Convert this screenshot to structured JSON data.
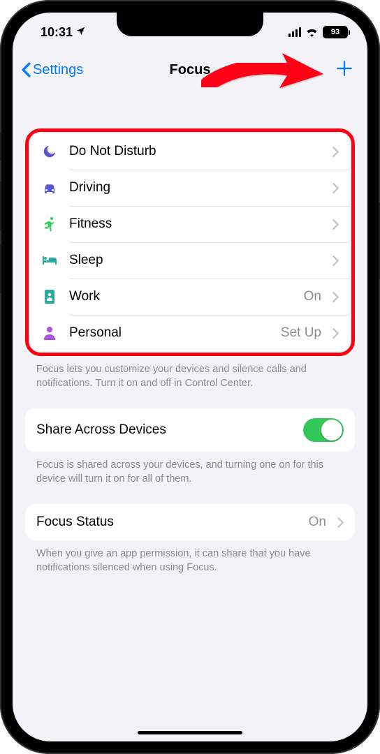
{
  "status": {
    "time": "10:31",
    "battery": "93"
  },
  "nav": {
    "back": "Settings",
    "title": "Focus"
  },
  "focus_modes": [
    {
      "label": "Do Not Disturb",
      "value": "",
      "icon": "moon",
      "color": "#5856d6"
    },
    {
      "label": "Driving",
      "value": "",
      "icon": "car",
      "color": "#5856d6"
    },
    {
      "label": "Fitness",
      "value": "",
      "icon": "runner",
      "color": "#30d158"
    },
    {
      "label": "Sleep",
      "value": "",
      "icon": "bed",
      "color": "#2aaaa0"
    },
    {
      "label": "Work",
      "value": "On",
      "icon": "badge",
      "color": "#2aaaa0"
    },
    {
      "label": "Personal",
      "value": "Set Up",
      "icon": "person",
      "color": "#af52de"
    }
  ],
  "focus_footer": "Focus lets you customize your devices and silence calls and notifications. Turn it on and off in Control Center.",
  "share": {
    "label": "Share Across Devices",
    "on": true,
    "footer": "Focus is shared across your devices, and turning one on for this device will turn it on for all of them."
  },
  "focus_status": {
    "label": "Focus Status",
    "value": "On",
    "footer": "When you give an app permission, it can share that you have notifications silenced when using Focus."
  }
}
